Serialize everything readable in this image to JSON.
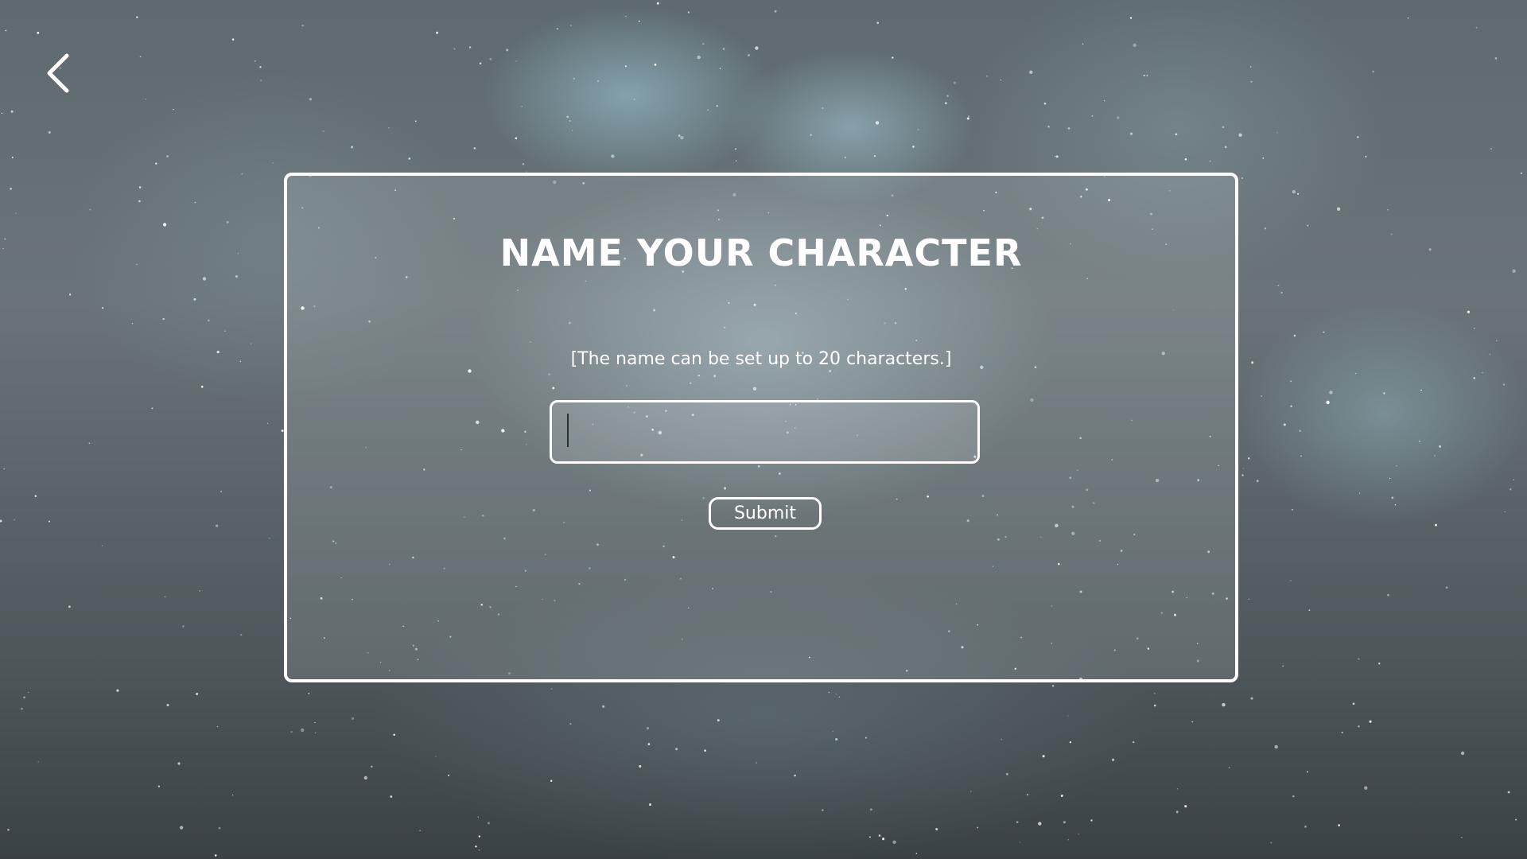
{
  "header": {
    "back_icon": "chevron-left-icon"
  },
  "dialog": {
    "title": "NAME YOUR CHARACTER",
    "hint": "[The name can be set up to 20 characters.]",
    "name_input": {
      "value": "",
      "placeholder": ""
    },
    "submit_label": "Submit"
  },
  "colors": {
    "foreground": "#ffffff",
    "background_dark": "#3b4245",
    "background_light": "#6a7478"
  }
}
